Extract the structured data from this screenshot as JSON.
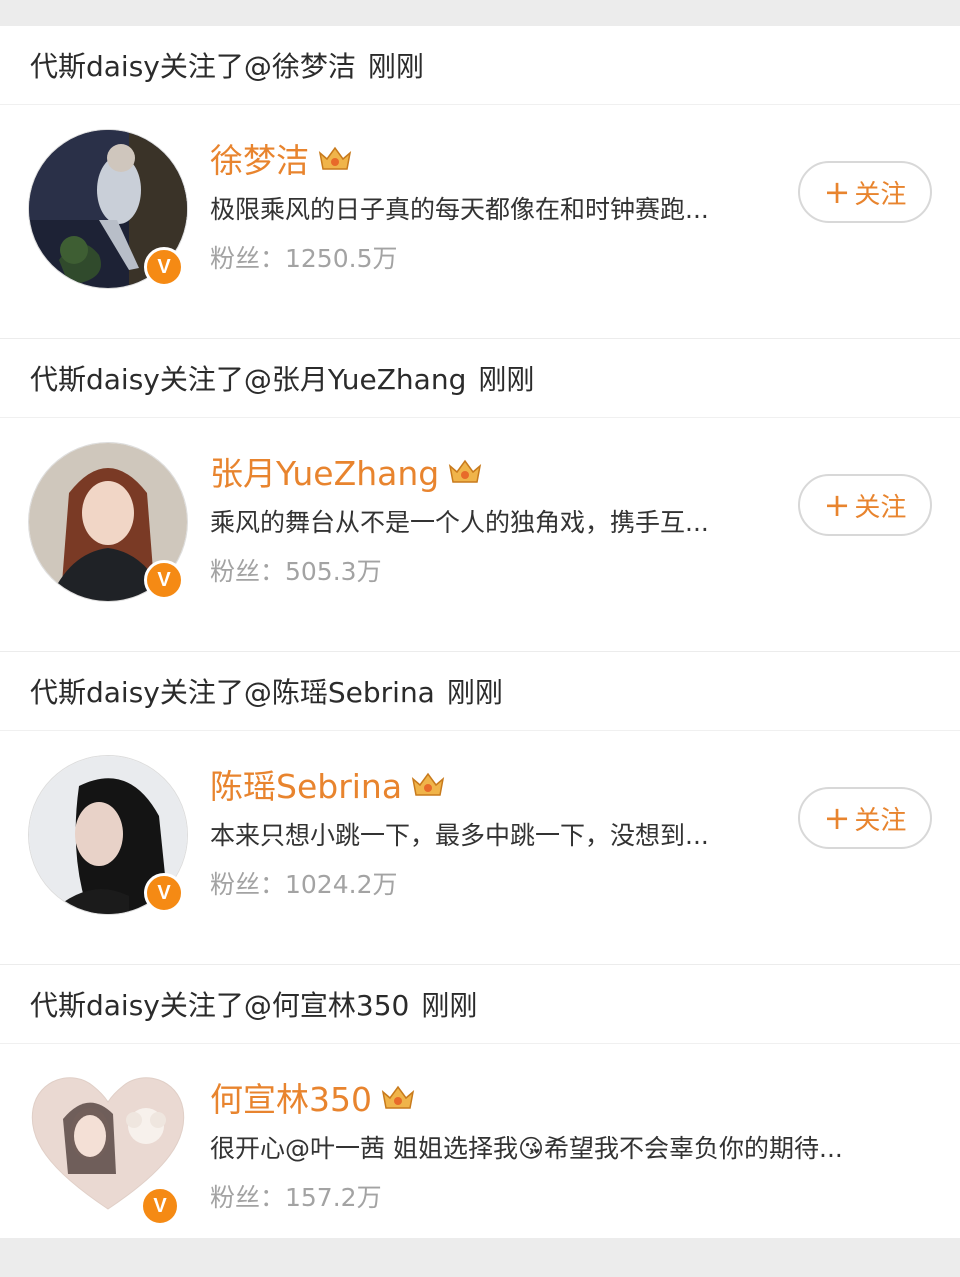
{
  "feed": [
    {
      "header": {
        "actor": "代斯daisy关注了",
        "target": "@徐梦洁",
        "time": "刚刚"
      },
      "user": {
        "name": "徐梦洁",
        "desc": "极限乘风的日子真的每天都像在和时钟赛跑...",
        "fans": "粉丝：1250.5万",
        "follow_label": "关注",
        "follow_plus": "+",
        "verified": "V",
        "avatar_icon": "avatar-night-photo",
        "crown_icon": "crown-icon"
      }
    },
    {
      "header": {
        "actor": "代斯daisy关注了",
        "target": "@张月YueZhang",
        "time": "刚刚"
      },
      "user": {
        "name": "张月YueZhang",
        "desc": "乘风的舞台从不是一个人的独角戏，携手互...",
        "fans": "粉丝：505.3万",
        "follow_label": "关注",
        "follow_plus": "+",
        "verified": "V",
        "avatar_icon": "avatar-portrait-red-hair",
        "crown_icon": "crown-icon"
      }
    },
    {
      "header": {
        "actor": "代斯daisy关注了",
        "target": "@陈瑶Sebrina",
        "time": "刚刚"
      },
      "user": {
        "name": "陈瑶Sebrina",
        "desc": "本来只想小跳一下，最多中跳一下，没想到...",
        "fans": "粉丝：1024.2万",
        "follow_label": "关注",
        "follow_plus": "+",
        "verified": "V",
        "avatar_icon": "avatar-profile-dark-hair",
        "crown_icon": "crown-icon"
      }
    },
    {
      "header": {
        "actor": "代斯daisy关注了",
        "target": "@何宣林350",
        "time": "刚刚"
      },
      "user": {
        "name": "何宣林350",
        "desc": "很开心@叶一茜 姐姐选择我😘希望我不会辜负你的期待...",
        "fans": "粉丝：157.2万",
        "verified": "V",
        "avatar_icon": "avatar-heart-with-dog",
        "crown_icon": "crown-icon"
      }
    }
  ],
  "colors": {
    "accent": "#e8842e",
    "verified_badge": "#f58a14",
    "background": "#ececec",
    "muted_text": "#a3a3a3"
  }
}
